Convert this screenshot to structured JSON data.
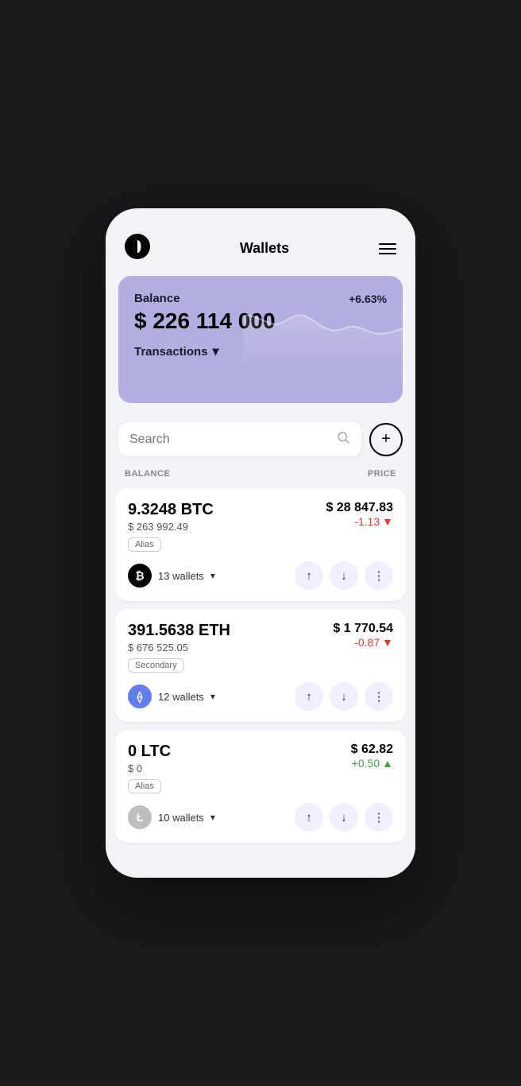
{
  "app": {
    "title": "Wallets"
  },
  "header": {
    "title": "Wallets",
    "menu_label": "menu"
  },
  "balance_card": {
    "label": "Balance",
    "percent": "+6.63%",
    "amount": "$ 226 114 000",
    "transactions_label": "Transactions"
  },
  "search": {
    "placeholder": "Search"
  },
  "columns": {
    "balance": "BALANCE",
    "price": "PRICE"
  },
  "assets": [
    {
      "name": "9.3248 BTC",
      "usd_value": "$ 263 992.49",
      "alias": "Alias",
      "wallets": "13 wallets",
      "price": "$ 28 847.83",
      "change": "-1.13",
      "change_dir": "neg",
      "icon_text": "₿",
      "icon_type": "btc"
    },
    {
      "name": "391.5638 ETH",
      "usd_value": "$ 676 525.05",
      "alias": "Secondary",
      "wallets": "12 wallets",
      "price": "$ 1 770.54",
      "change": "-0.87",
      "change_dir": "neg",
      "icon_text": "⟠",
      "icon_type": "eth"
    },
    {
      "name": "0 LTC",
      "usd_value": "$ 0",
      "alias": "Alias",
      "wallets": "10 wallets",
      "price": "$ 62.82",
      "change": "+0.50",
      "change_dir": "pos",
      "icon_text": "Ł",
      "icon_type": "ltc"
    }
  ],
  "icons": {
    "send": "↑",
    "receive": "↓",
    "more": "⋮",
    "chevron_down": "▾",
    "search": "🔍",
    "add": "+",
    "menu_line1": "",
    "menu_line2": "",
    "menu_line3": ""
  }
}
